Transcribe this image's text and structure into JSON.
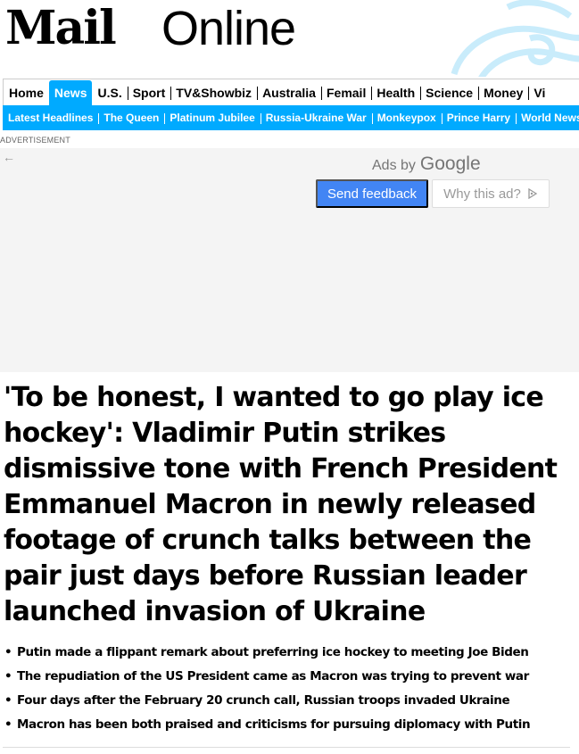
{
  "brand": {
    "mail": "Mail",
    "online": "Online"
  },
  "nav": {
    "primary": [
      "Home",
      "News",
      "U.S.",
      "Sport",
      "TV&Showbiz",
      "Australia",
      "Femail",
      "Health",
      "Science",
      "Money",
      "Vi"
    ],
    "active": "News",
    "secondary": [
      "Latest Headlines",
      "The Queen",
      "Platinum Jubilee",
      "Russia-Ukraine War",
      "Monkeypox",
      "Prince Harry",
      "World News"
    ]
  },
  "ad": {
    "label": "ADVERTISEMENT",
    "ads_by": "Ads by",
    "google": "Google",
    "send_feedback": "Send feedback",
    "why_this_ad": "Why this ad?"
  },
  "article": {
    "headline": "'To be honest, I wanted to go play ice hockey': Vladimir Putin strikes dismissive tone with French President Emmanuel Macron in newly released footage of crunch talks between the pair just days before Russian leader launched invasion of Ukraine",
    "bullets": [
      "Putin made a flippant remark about preferring ice hockey to meeting Joe Biden",
      "The repudiation of the US President came as Macron was trying to prevent war",
      "Four days after the February 20 crunch call, Russian troops invaded Ukraine",
      "Macron has been both praised and criticisms for pursuing diplomacy with Putin"
    ]
  },
  "colors": {
    "accent": "#00aaff",
    "google_blue": "#4285f4",
    "ad_bg": "#f4f4f4"
  }
}
